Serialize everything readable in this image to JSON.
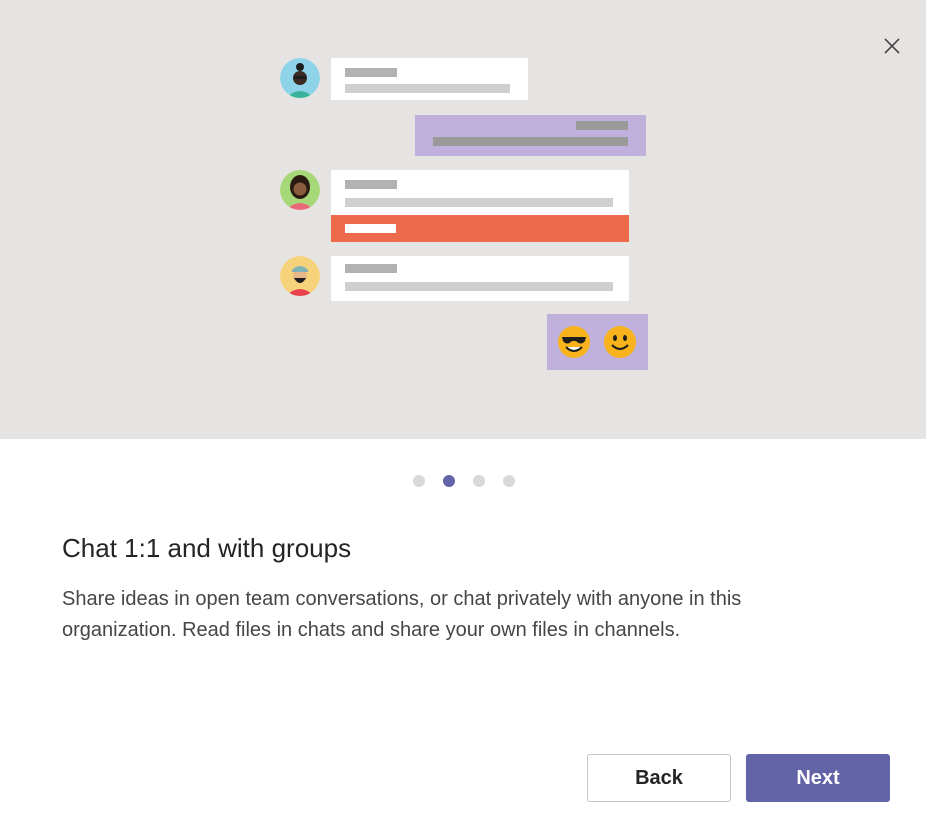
{
  "dialog": {
    "close_icon": "close-icon",
    "illustration": {
      "background": "#e5e4e3",
      "accent_purple": "#bfb1dc",
      "accent_red": "#ee6a4c",
      "emojis": [
        "sunglasses-emoji-icon",
        "smile-emoji-icon"
      ]
    },
    "carousel": {
      "total": 4,
      "active_index": 1
    },
    "title": "Chat 1:1 and with groups",
    "description": "Share ideas in open team conversations, or chat privately with anyone in this organization. Read files in chats and share your own files in channels.",
    "buttons": {
      "back_label": "Back",
      "next_label": "Next"
    },
    "colors": {
      "brand": "#6264a7",
      "title_text": "#252423",
      "body_text": "#484644"
    }
  }
}
